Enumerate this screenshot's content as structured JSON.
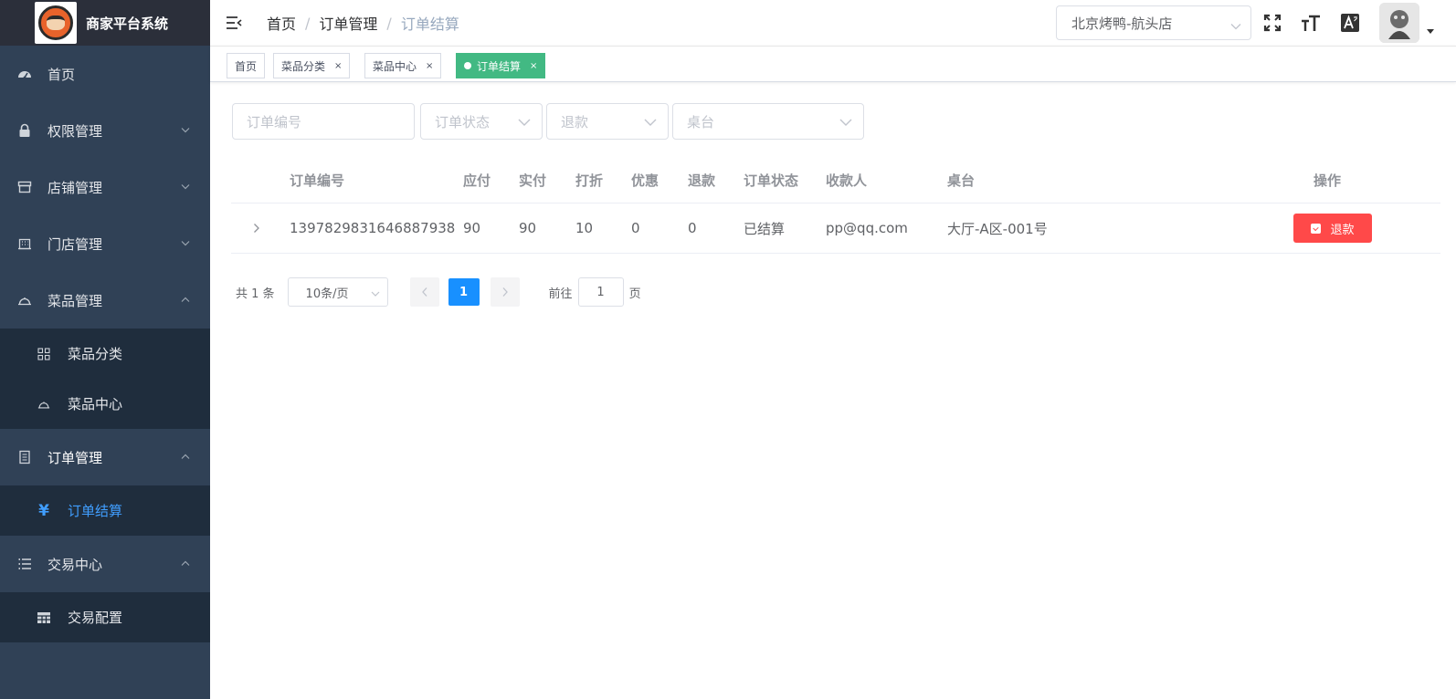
{
  "app": {
    "title": "商家平台系统"
  },
  "sidebar": {
    "items": [
      {
        "label": "首页",
        "icon": "dashboard-icon"
      },
      {
        "label": "权限管理",
        "icon": "lock-icon"
      },
      {
        "label": "店铺管理",
        "icon": "shop-icon"
      },
      {
        "label": "门店管理",
        "icon": "building-icon"
      },
      {
        "label": "菜品管理",
        "icon": "dish-icon",
        "children": [
          {
            "label": "菜品分类",
            "icon": "grid-icon"
          },
          {
            "label": "菜品中心",
            "icon": "dish-icon"
          }
        ]
      },
      {
        "label": "订单管理",
        "icon": "document-icon",
        "children": [
          {
            "label": "订单结算",
            "icon": "yen-icon"
          }
        ]
      },
      {
        "label": "交易中心",
        "icon": "list-icon",
        "children": [
          {
            "label": "交易配置",
            "icon": "table-icon"
          }
        ]
      }
    ],
    "active_color": "#409eff"
  },
  "breadcrumb": [
    "首页",
    "订单管理",
    "订单结算"
  ],
  "header": {
    "store": "北京烤鸭-航头店",
    "icons": [
      "fullscreen-icon",
      "font-size-icon",
      "translate-icon"
    ]
  },
  "tags": [
    {
      "label": "首页",
      "closable": false
    },
    {
      "label": "菜品分类",
      "closable": true
    },
    {
      "label": "菜品中心",
      "closable": true
    },
    {
      "label": "订单结算",
      "closable": true,
      "active": true
    }
  ],
  "filters": {
    "order_no_placeholder": "订单编号",
    "status_placeholder": "订单状态",
    "refund_placeholder": "退款",
    "table_placeholder": "桌台"
  },
  "table": {
    "headers": [
      "订单编号",
      "应付",
      "实付",
      "打折",
      "优惠",
      "退款",
      "订单状态",
      "收款人",
      "桌台",
      "操作"
    ],
    "rows": [
      {
        "order_no": "1397829831646887938",
        "payable": "90",
        "paid": "90",
        "discount": "10",
        "coupon": "0",
        "refund": "0",
        "status": "已结算",
        "payee": "pp@qq.com",
        "table": "大厅-A区-001号",
        "action": "退款"
      }
    ]
  },
  "pagination": {
    "total_text": "共 1 条",
    "page_size": "10条/页",
    "current_page": "1",
    "goto_label": "前往",
    "goto_value": "1",
    "page_suffix": "页"
  },
  "colors": {
    "sidebar_bg": "#304156",
    "tag_active": "#42b983",
    "danger": "#ff4949",
    "primary": "#1890ff"
  }
}
